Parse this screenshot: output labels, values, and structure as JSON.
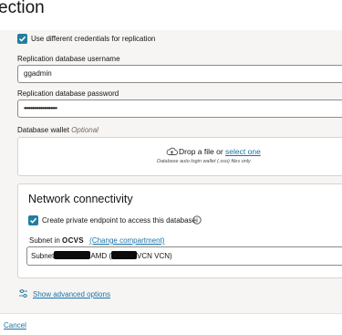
{
  "header": {
    "title": "ection"
  },
  "replication": {
    "checkbox_label": "Use different credentials for replication",
    "checked": true,
    "username_label": "Replication database username",
    "username_value": "ggadmin",
    "password_label": "Replication database password",
    "password_value": "••••••••••••••••••••"
  },
  "wallet": {
    "label": "Database wallet",
    "optional": "Optional",
    "drop_text": "Drop a file or",
    "select_link": "select one",
    "hint": "Database auto login wallet (.sso) files only"
  },
  "network": {
    "title": "Network connectivity",
    "private_endpoint_label": "Create private endpoint to access this database",
    "private_endpoint_checked": true,
    "subnet_label_prefix": "Subnet in",
    "compartment": "OCVS",
    "change_compartment": "(Change compartment)",
    "subnet_value_a": "Subnet",
    "subnet_value_b": "AMD (",
    "subnet_value_c": "VCN VCN)"
  },
  "advanced": {
    "label": "Show advanced options"
  },
  "footer": {
    "cancel": "Cancel"
  },
  "colors": {
    "accent": "#227e9e",
    "link": "#1a73a8"
  }
}
